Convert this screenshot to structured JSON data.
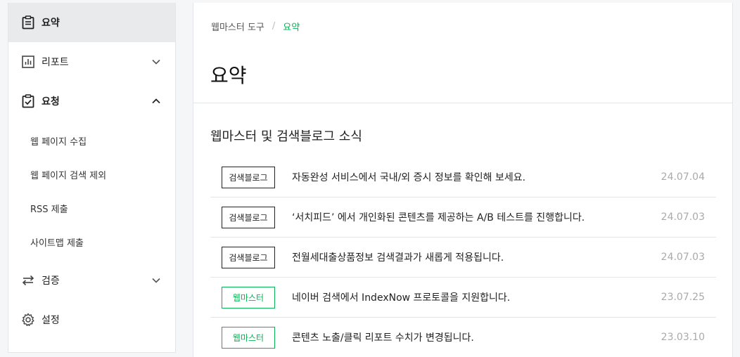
{
  "sidebar": {
    "items": [
      {
        "label": "요약",
        "icon": "clipboard-icon",
        "active": true
      },
      {
        "label": "리포트",
        "icon": "bar-chart-icon",
        "chevron": "chevron-down-icon"
      },
      {
        "label": "요청",
        "icon": "clipboard-check-icon",
        "chevron": "chevron-up-icon",
        "expanded": true,
        "sub_items": [
          "웹 페이지 수집",
          "웹 페이지 검색 제외",
          "RSS 제출",
          "사이트맵 제출"
        ]
      },
      {
        "label": "검증",
        "icon": "swap-arrows-icon",
        "chevron": "chevron-down-icon"
      },
      {
        "label": "설정",
        "icon": "gear-icon"
      }
    ]
  },
  "breadcrumb": {
    "root": "웹마스터 도구",
    "separator": "/",
    "current": "요약"
  },
  "page_title": "요약",
  "news": {
    "title": "웹마스터 및 검색블로그 소식",
    "rows": [
      {
        "tag": "검색블로그",
        "text": "자동완성 서비스에서 국내/외 증시 정보를 확인해 보세요.",
        "date": "24.07.04"
      },
      {
        "tag": "검색블로그",
        "text": "‘서치피드’ 에서 개인화된 콘텐츠를 제공하는 A/B 테스트를 진행합니다.",
        "date": "24.07.03"
      },
      {
        "tag": "검색블로그",
        "text": "전월세대출상품정보 검색결과가 새롭게 적용됩니다.",
        "date": "24.07.03"
      },
      {
        "tag": "웹마스터",
        "text": "네이버 검색에서 IndexNow 프로토콜을 지원합니다.",
        "date": "23.07.25"
      },
      {
        "tag": "웹마스터",
        "text": "콘텐츠 노출/클릭 리포트 수치가 변경됩니다.",
        "date": "23.03.10"
      }
    ]
  },
  "colors": {
    "accent": "#08b455",
    "border": "#e3e5e8",
    "active_bg": "#e9eaec",
    "date": "#aaaaaa"
  }
}
